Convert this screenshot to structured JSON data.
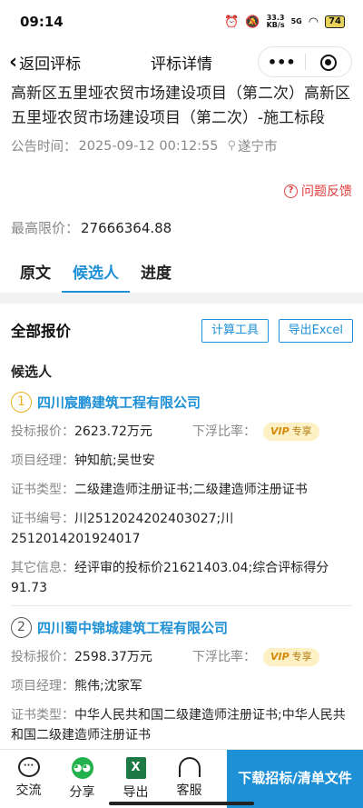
{
  "status_bar": {
    "time": "09:14",
    "net_speed_value": "33.3",
    "net_speed_unit": "KB/s",
    "signal": "5G",
    "battery": "74",
    "icons": [
      "alarm-icon",
      "mute-icon",
      "signal-icon",
      "wifi-icon",
      "battery-icon"
    ]
  },
  "nav": {
    "back_label": "返回评标",
    "title": "评标详情",
    "more_label": "•••"
  },
  "header": {
    "title": "高新区五里垭农贸市场建设项目（第二次）高新区五里垭农贸市场建设项目（第二次）-施工标段",
    "publish_label": "公告时间：",
    "publish_time": "2025-09-12 00:12:55",
    "location": "遂宁市",
    "feedback": "问题反馈",
    "max_price_label": "最高限价：",
    "max_price": "27666364.88"
  },
  "tabs": [
    {
      "label": "原文"
    },
    {
      "label": "候选人"
    },
    {
      "label": "进度"
    }
  ],
  "section": {
    "title": "全部报价",
    "calc_button": "计算工具",
    "export_button": "导出Excel",
    "candidates_label": "候选人"
  },
  "labels": {
    "bid_price": "投标报价：",
    "float_rate": "下浮比率：",
    "vip": "专享",
    "vip_mark": "VIP",
    "manager": "项目经理：",
    "cert_type": "证书类型：",
    "cert_no": "证书编号：",
    "other": "其它信息："
  },
  "candidates": [
    {
      "rank": "1",
      "name": "四川宸鹏建筑工程有限公司",
      "bid_price": "2623.72万元",
      "manager": "钟知航;吴世安",
      "cert_type": "二级建造师注册证书;二级建造师注册证书",
      "cert_no": "川2512024202403027;川2512014201924017",
      "other": "经评审的投标价21621403.04;综合评标得分91.73"
    },
    {
      "rank": "2",
      "name": "四川蜀中锦城建筑工程有限公司",
      "bid_price": "2598.37万元",
      "manager": "熊伟;沈家军",
      "cert_type": "中华人民共和国二级建造师注册证书;中华人民共和国二级建造师注册证书"
    }
  ],
  "bottom_bar": {
    "chat": "交流",
    "share": "分享",
    "export": "导出",
    "service": "客服",
    "download": "下载招标/清单文件"
  }
}
